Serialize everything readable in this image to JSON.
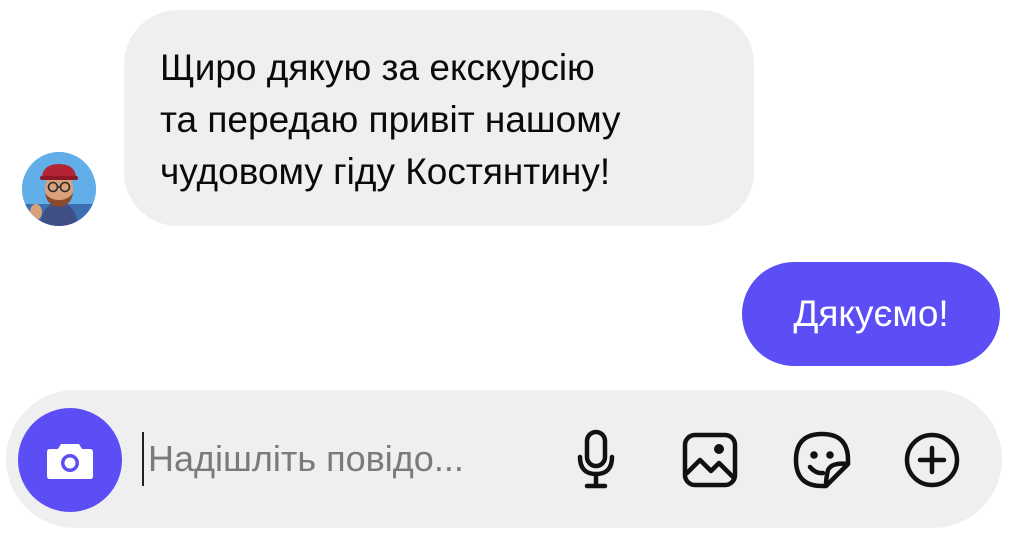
{
  "conversation": {
    "incoming_message": {
      "lines": [
        "Щиро дякую за екскурсію",
        "та передаю привіт нашому",
        "чудовому гіду Костянтину!"
      ]
    },
    "outgoing_message": {
      "text": "Дякуємо!"
    }
  },
  "composer": {
    "placeholder": "Надішліть повідо...",
    "value": ""
  },
  "icons": {
    "camera": "camera-icon",
    "microphone": "microphone-icon",
    "gallery": "image-gallery-icon",
    "sticker": "sticker-icon",
    "add": "plus-circle-icon"
  },
  "colors": {
    "accent": "#5b4ef5",
    "incoming_bubble": "#efefef",
    "composer_background": "#efefef",
    "text_primary": "#0a0a0a"
  }
}
